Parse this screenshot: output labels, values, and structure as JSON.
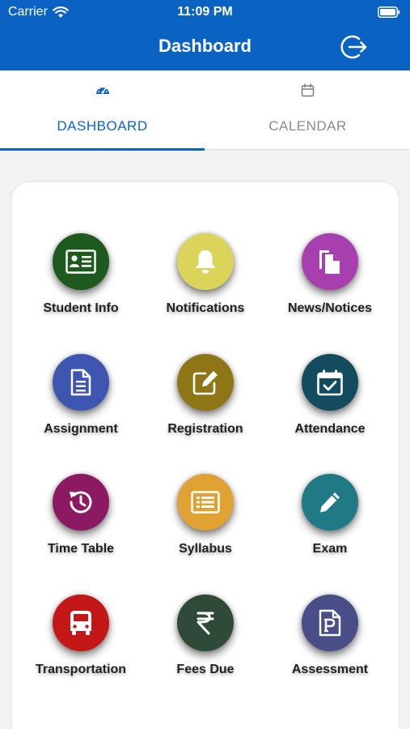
{
  "status_bar": {
    "carrier": "Carrier",
    "time": "11:09 PM"
  },
  "header": {
    "title": "Dashboard",
    "logout_icon": "logout-icon"
  },
  "tabs": [
    {
      "label": "DASHBOARD",
      "icon": "speedometer-icon",
      "active": true
    },
    {
      "label": "CALENDAR",
      "icon": "calendar-icon",
      "active": false
    }
  ],
  "colors": {
    "primary": "#0a63c2",
    "student_info": "#1e5a1e",
    "notifications": "#dcd45a",
    "news_notices": "#a83fae",
    "assignment": "#3f56b0",
    "registration": "#8e7616",
    "attendance": "#124c5e",
    "time_table": "#8b1a62",
    "syllabus": "#e0a232",
    "exam": "#1f7a86",
    "transportation": "#c41818",
    "fees_due": "#2f4a38",
    "assessment": "#4a4e88"
  },
  "tiles": [
    {
      "label": "Student Info",
      "icon": "id-card-icon"
    },
    {
      "label": "Notifications",
      "icon": "bell-icon"
    },
    {
      "label": "News/Notices",
      "icon": "documents-icon"
    },
    {
      "label": "Assignment",
      "icon": "document-icon"
    },
    {
      "label": "Registration",
      "icon": "edit-icon"
    },
    {
      "label": "Attendance",
      "icon": "calendar-check-icon"
    },
    {
      "label": "Time Table",
      "icon": "history-icon"
    },
    {
      "label": "Syllabus",
      "icon": "list-icon"
    },
    {
      "label": "Exam",
      "icon": "pencil-icon"
    },
    {
      "label": "Transportation",
      "icon": "bus-icon"
    },
    {
      "label": "Fees Due",
      "icon": "rupee-icon"
    },
    {
      "label": "Assessment",
      "icon": "p-document-icon"
    }
  ]
}
